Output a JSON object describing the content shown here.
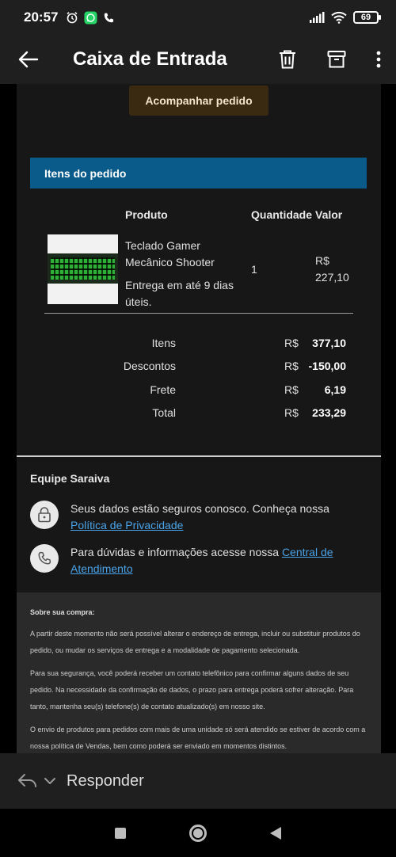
{
  "status_bar": {
    "time": "20:57",
    "battery": "69"
  },
  "app_bar": {
    "title": "Caixa de Entrada"
  },
  "email": {
    "track_button": "Acompanhar pedido",
    "items_header": "Itens do pedido",
    "columns": {
      "product": "Produto",
      "quantity": "Quantidade",
      "value": "Valor"
    },
    "product": {
      "name": "Teclado Gamer Mecânico Shooter",
      "delivery": "Entrega em até 9 dias úteis.",
      "quantity": "1",
      "price": "R$ 227,10"
    },
    "summary": [
      {
        "label": "Itens",
        "currency": "R$",
        "value": "377,10"
      },
      {
        "label": "Descontos",
        "currency": "R$",
        "value": "-150,00"
      },
      {
        "label": "Frete",
        "currency": "R$",
        "value": "6,19"
      },
      {
        "label": "Total",
        "currency": "R$",
        "value": "233,29"
      }
    ],
    "team": {
      "title": "Equipe Saraiva",
      "privacy_text": "Seus dados estão seguros conosco. Conheça nossa ",
      "privacy_link": "Política de Privacidade",
      "support_text": "Para dúvidas e informações acesse nossa ",
      "support_link": "Central de Atendimento"
    },
    "about": {
      "title": "Sobre sua compra:",
      "p1": "A partir deste momento não será possível alterar o endereço de entrega, incluir ou substituir produtos do pedido, ou mudar os serviços de entrega e a modalidade de pagamento selecionada.",
      "p2": "Para sua segurança, você poderá receber um contato telefônico para confirmar alguns dados de seu pedido. Na necessidade da confirmação de dados, o prazo para entrega poderá sofrer alteração. Para tanto, mantenha seu(s) telefone(s) de contato atualizado(s) em nosso site.",
      "p3": "O envio de produtos para pedidos com mais de uma unidade só será atendido se estiver de acordo com a nossa política de Vendas, bem como poderá ser enviado em momentos distintos."
    }
  },
  "reply_bar": {
    "label": "Responder"
  },
  "icons": [
    "alarm-icon",
    "whatsapp-icon",
    "phone-icon",
    "signal-icon",
    "wifi-icon",
    "battery-icon",
    "back-arrow-icon",
    "trash-icon",
    "archive-icon",
    "more-vert-icon",
    "lock-icon",
    "phone-support-icon",
    "reply-icon",
    "chevron-down-icon"
  ]
}
